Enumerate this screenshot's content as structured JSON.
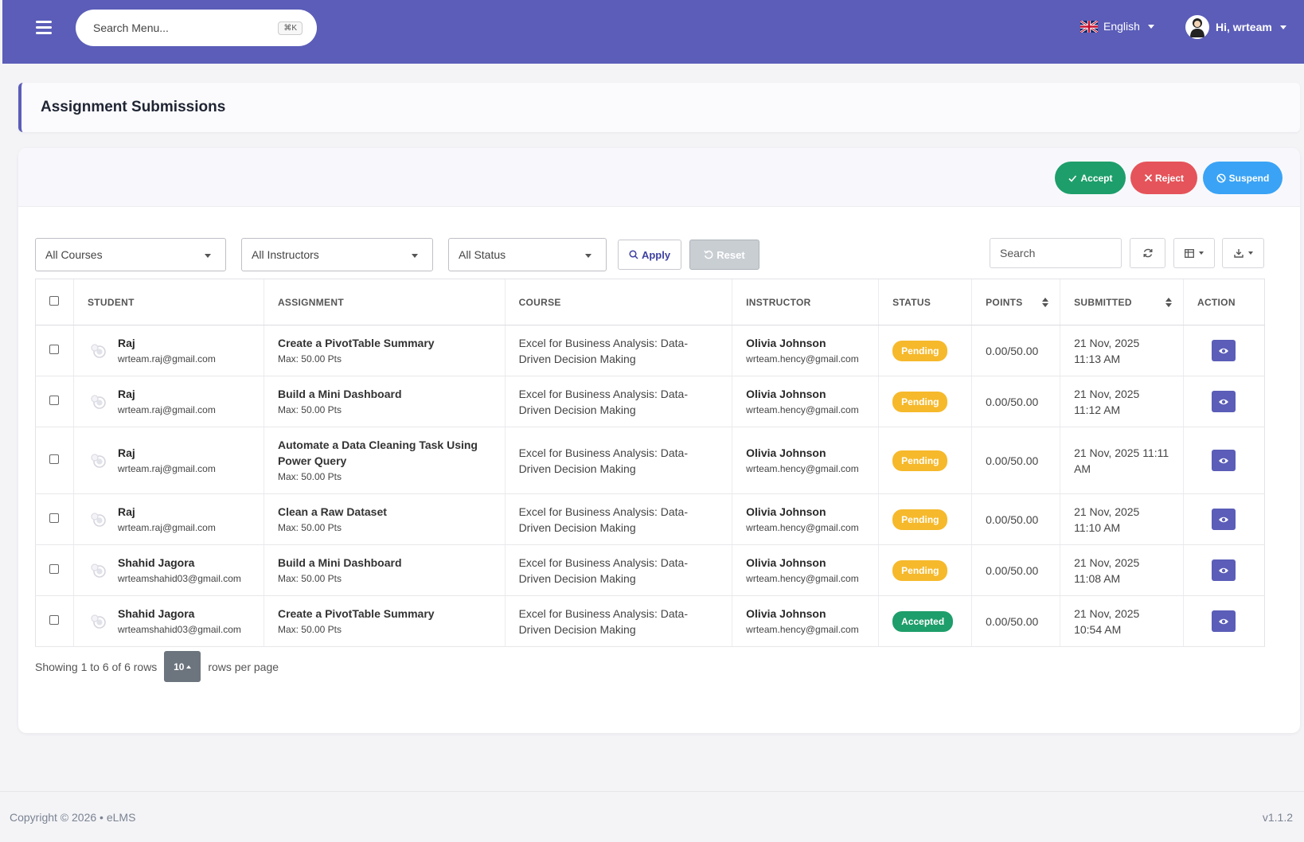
{
  "topbar": {
    "search_placeholder": "Search Menu...",
    "search_shortcut": "⌘K",
    "language": "English",
    "user_greeting": "Hi, wrteam"
  },
  "page": {
    "title": "Assignment Submissions"
  },
  "bulk_actions": {
    "accept": "Accept",
    "reject": "Reject",
    "suspend": "Suspend"
  },
  "filters": {
    "courses": "All Courses",
    "instructors": "All Instructors",
    "status": "All Status",
    "apply": "Apply",
    "reset": "Reset",
    "search_placeholder": "Search"
  },
  "table": {
    "headers": [
      "STUDENT",
      "ASSIGNMENT",
      "COURSE",
      "INSTRUCTOR",
      "STATUS",
      "POINTS",
      "SUBMITTED",
      "ACTION"
    ],
    "rows": [
      {
        "student": "Raj",
        "email": "wrteam.raj@gmail.com",
        "assignment": "Create a PivotTable Summary",
        "max": "Max: 50.00 Pts",
        "course": "Excel for Business Analysis: Data-Driven Decision Making",
        "instructor": "Olivia Johnson",
        "instructor_email": "wrteam.hency@gmail.com",
        "status": "Pending",
        "points": "0.00/50.00",
        "submitted": "21 Nov, 2025 11:13 AM"
      },
      {
        "student": "Raj",
        "email": "wrteam.raj@gmail.com",
        "assignment": "Build a Mini Dashboard",
        "max": "Max: 50.00 Pts",
        "course": "Excel for Business Analysis: Data-Driven Decision Making",
        "instructor": "Olivia Johnson",
        "instructor_email": "wrteam.hency@gmail.com",
        "status": "Pending",
        "points": "0.00/50.00",
        "submitted": "21 Nov, 2025 11:12 AM"
      },
      {
        "student": "Raj",
        "email": "wrteam.raj@gmail.com",
        "assignment": "Automate a Data Cleaning Task Using Power Query",
        "max": "Max: 50.00 Pts",
        "course": "Excel for Business Analysis: Data-Driven Decision Making",
        "instructor": "Olivia Johnson",
        "instructor_email": "wrteam.hency@gmail.com",
        "status": "Pending",
        "points": "0.00/50.00",
        "submitted": "21 Nov, 2025 11:11 AM"
      },
      {
        "student": "Raj",
        "email": "wrteam.raj@gmail.com",
        "assignment": "Clean a Raw Dataset",
        "max": "Max: 50.00 Pts",
        "course": "Excel for Business Analysis: Data-Driven Decision Making",
        "instructor": "Olivia Johnson",
        "instructor_email": "wrteam.hency@gmail.com",
        "status": "Pending",
        "points": "0.00/50.00",
        "submitted": "21 Nov, 2025 11:10 AM"
      },
      {
        "student": "Shahid Jagora",
        "email": "wrteamshahid03@gmail.com",
        "assignment": "Build a Mini Dashboard",
        "max": "Max: 50.00 Pts",
        "course": "Excel for Business Analysis: Data-Driven Decision Making",
        "instructor": "Olivia Johnson",
        "instructor_email": "wrteam.hency@gmail.com",
        "status": "Pending",
        "points": "0.00/50.00",
        "submitted": "21 Nov, 2025 11:08 AM"
      },
      {
        "student": "Shahid Jagora",
        "email": "wrteamshahid03@gmail.com",
        "assignment": "Create a PivotTable Summary",
        "max": "Max: 50.00 Pts",
        "course": "Excel for Business Analysis: Data-Driven Decision Making",
        "instructor": "Olivia Johnson",
        "instructor_email": "wrteam.hency@gmail.com",
        "status": "Accepted",
        "points": "0.00/50.00",
        "submitted": "21 Nov, 2025 10:54 AM"
      }
    ]
  },
  "pagination": {
    "showing": "Showing 1 to 6 of 6 rows",
    "per_page": "10",
    "rows_per_page": "rows per page"
  },
  "footer": {
    "copyright": "Copyright © 2026 • eLMS",
    "version": "v1.1.2"
  },
  "colors": {
    "brand": "#5b5db8",
    "accept": "#1e9e6a",
    "reject": "#e5545a",
    "suspend": "#3aa3f5",
    "pending": "#f6b92b"
  },
  "icons": [
    "hamburger-icon",
    "uk-flag-icon",
    "user-avatar-icon",
    "check-icon",
    "x-icon",
    "ban-icon",
    "search-icon",
    "reset-icon",
    "refresh-icon",
    "columns-icon",
    "download-icon",
    "student-avatar-icon",
    "eye-icon"
  ]
}
